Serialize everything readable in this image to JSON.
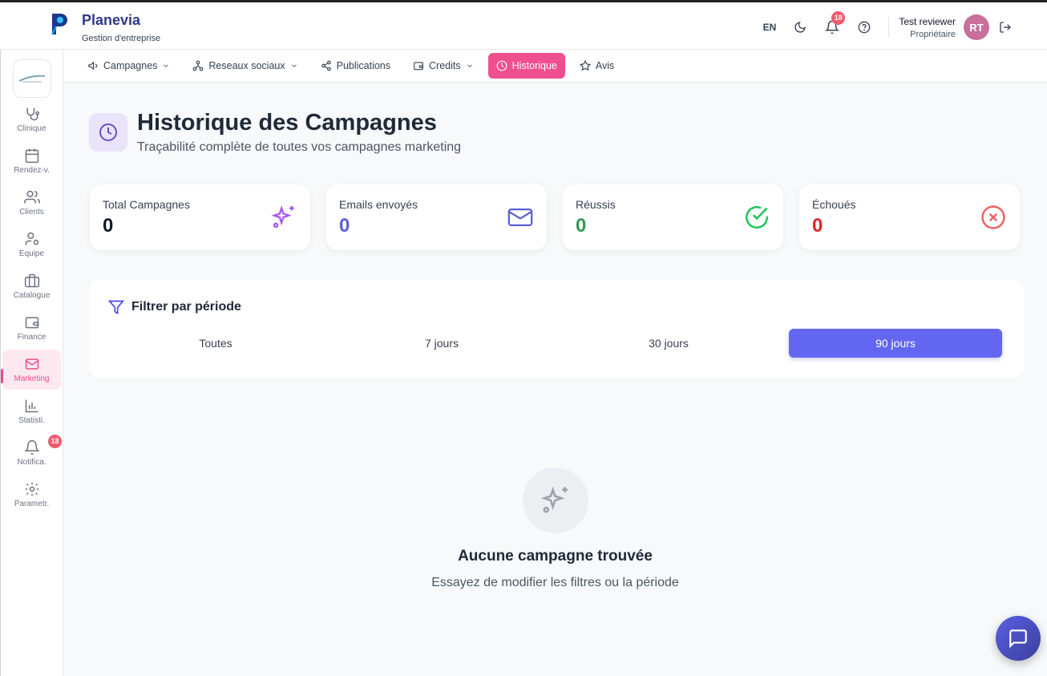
{
  "header": {
    "brand_name": "Planevia",
    "brand_subtitle": "Gestion d'entreprise",
    "language": "EN",
    "notification_count": "18",
    "user_name": "Test reviewer",
    "user_role": "Propriétaire",
    "avatar_initials": "RT"
  },
  "sidebar": {
    "items": [
      {
        "label": "Clinique",
        "icon": "stethoscope-icon"
      },
      {
        "label": "Rendez-v.",
        "icon": "calendar-icon"
      },
      {
        "label": "Clients",
        "icon": "users-icon"
      },
      {
        "label": "Equipe",
        "icon": "team-icon"
      },
      {
        "label": "Catalogue",
        "icon": "briefcase-icon"
      },
      {
        "label": "Finance",
        "icon": "wallet-icon"
      },
      {
        "label": "Marketing",
        "icon": "mail-icon"
      },
      {
        "label": "Statisti.",
        "icon": "bar-chart-icon"
      },
      {
        "label": "Notifica.",
        "icon": "bell-icon"
      },
      {
        "label": "Parametr.",
        "icon": "gear-icon"
      }
    ],
    "active": "Marketing",
    "notification_badge": "18"
  },
  "tabs": [
    {
      "label": "Campagnes"
    },
    {
      "label": "Reseaux sociaux"
    },
    {
      "label": "Publications"
    },
    {
      "label": "Credits"
    },
    {
      "label": "Historique"
    },
    {
      "label": "Avis"
    }
  ],
  "page": {
    "title": "Historique des Campagnes",
    "subtitle": "Traçabilité complète de toutes vos campagnes marketing"
  },
  "stats": [
    {
      "label": "Total Campagnes",
      "value": "0",
      "color": "#111827",
      "icon": "sparkles-icon"
    },
    {
      "label": "Emails envoyés",
      "value": "0",
      "color": "#5b5fd6",
      "icon": "mail-icon"
    },
    {
      "label": "Réussis",
      "value": "0",
      "color": "#2e9e4f",
      "icon": "check-circle-icon"
    },
    {
      "label": "Échoués",
      "value": "0",
      "color": "#dc2626",
      "icon": "x-circle-icon"
    }
  ],
  "filter": {
    "title": "Filtrer par période",
    "periods": [
      "Toutes",
      "7 jours",
      "30 jours",
      "90 jours"
    ],
    "selected": "90 jours"
  },
  "empty_state": {
    "title": "Aucune campagne trouvée",
    "subtitle": "Essayez de modifier les filtres ou la période"
  },
  "colors": {
    "accent_pink": "#ef4f8f",
    "accent_indigo": "#6366f1",
    "brand_navy": "#2e3a8c"
  }
}
